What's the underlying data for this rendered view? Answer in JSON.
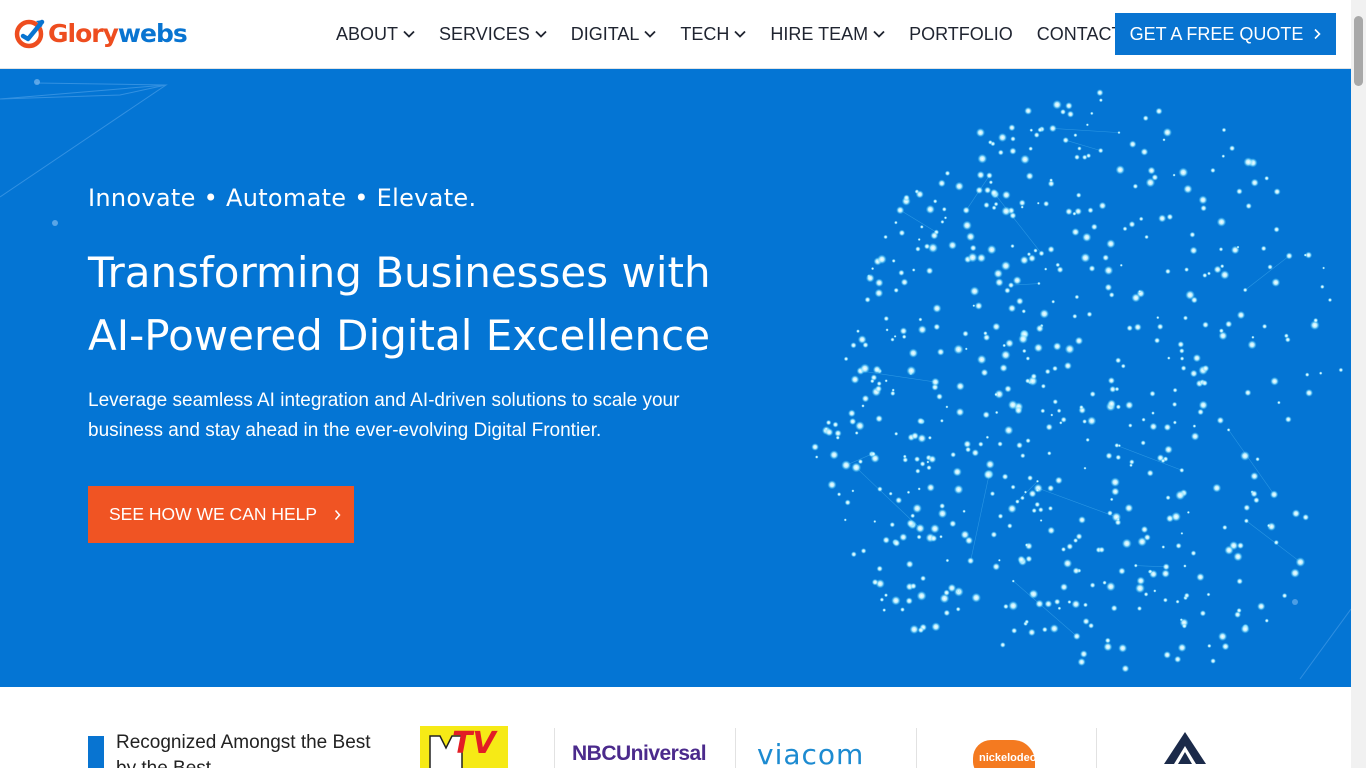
{
  "header": {
    "logo": {
      "part1": "Glory",
      "part2": "webs",
      "icon": "glorywebs-logo-icon"
    },
    "nav": [
      {
        "label": "ABOUT",
        "has_dropdown": true
      },
      {
        "label": "SERVICES",
        "has_dropdown": true
      },
      {
        "label": "DIGITAL",
        "has_dropdown": true
      },
      {
        "label": "TECH",
        "has_dropdown": true
      },
      {
        "label": "HIRE TEAM",
        "has_dropdown": true
      },
      {
        "label": "PORTFOLIO",
        "has_dropdown": false
      },
      {
        "label": "CONTACT",
        "has_dropdown": false
      }
    ],
    "cta_label": "GET A FREE QUOTE"
  },
  "hero": {
    "tagline": "Innovate • Automate • Elevate.",
    "title_line1": "Transforming Businesses with",
    "title_line2": "AI-Powered Digital Excellence",
    "description": "Leverage seamless AI integration and AI-driven solutions to scale your business and stay ahead in the ever-evolving Digital Frontier.",
    "cta_label": "SEE HOW WE CAN HELP",
    "background_color": "#0475d4",
    "cta_color": "#f05423"
  },
  "recognition": {
    "text": "Recognized Amongst the Best by the Best",
    "brands": [
      {
        "name": "MTV",
        "label": "TV"
      },
      {
        "name": "NBCUniversal",
        "label": "NBCUniversal"
      },
      {
        "name": "Viacom",
        "label": "viacom"
      },
      {
        "name": "Nickelodeon",
        "label": "nickelodeon"
      },
      {
        "name": "All American Tax Relief",
        "label": ""
      }
    ]
  },
  "colors": {
    "brand_blue": "#0874d1",
    "brand_orange": "#ee4d1f"
  }
}
